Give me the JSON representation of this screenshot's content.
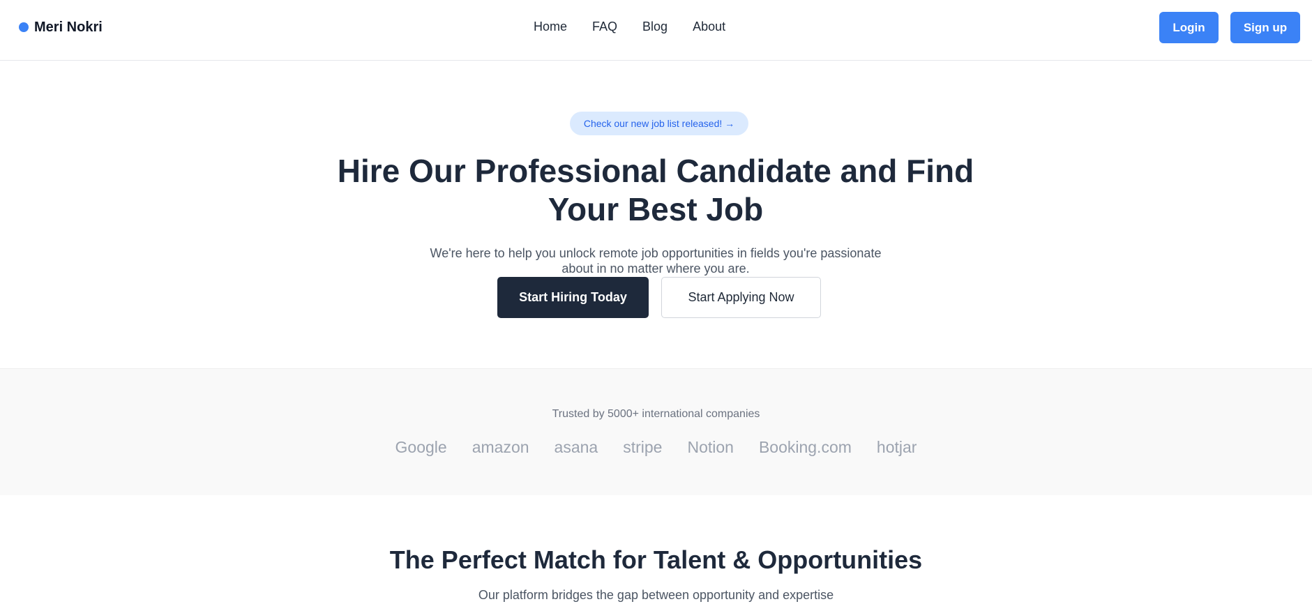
{
  "header": {
    "brand": "Meri Nokri",
    "nav": [
      "Home",
      "FAQ",
      "Blog",
      "About"
    ],
    "login_label": "Login",
    "signup_label": "Sign up"
  },
  "hero": {
    "announcement": "Check our new job list released! →",
    "title_line1": "Hire Our Professional Candidate and Find",
    "title_line2": "Your Best Job",
    "subtitle_line1": "We're here to help you unlock remote job opportunities in fields you're passionate",
    "subtitle_line2": "about in no matter where you are.",
    "primary_cta": "Start Hiring Today",
    "secondary_cta": "Start Applying Now"
  },
  "trusted": {
    "label": "Trusted by 5000+ international companies",
    "logos": [
      "Google",
      "amazon",
      "asana",
      "stripe",
      "Notion",
      "Booking.com",
      "hotjar"
    ]
  },
  "match": {
    "title": "The Perfect Match for Talent & Opportunities",
    "subtitle": "Our platform bridges the gap between opportunity and expertise"
  },
  "colors": {
    "accent": "#3b82f6",
    "dark": "#1e293b",
    "announcement_bg": "#dbeafe",
    "logo_gray": "#9ca3af",
    "band_bg": "#f9f9f9"
  }
}
